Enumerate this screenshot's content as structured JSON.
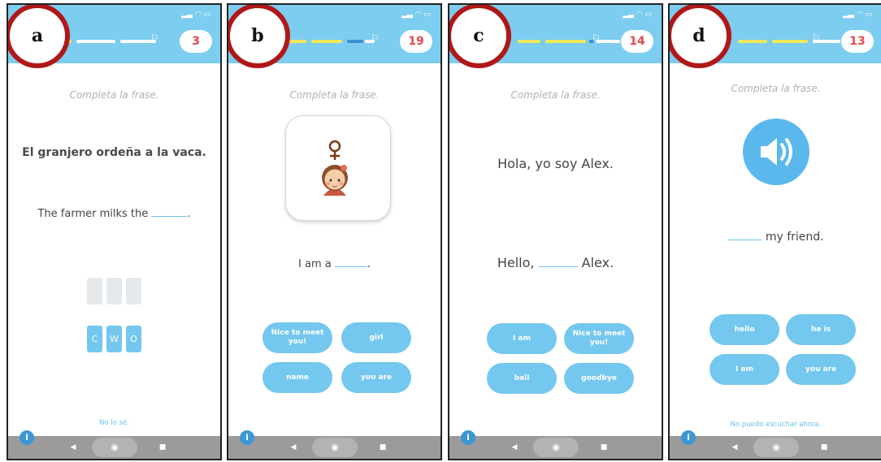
{
  "panels": [
    {
      "label": "a",
      "counter": "3",
      "instruction": "Completa la frase.",
      "prompt": "El granjero ordeña a la vaca.",
      "sentence_before": "The farmer milks the ",
      "sentence_after": ".",
      "letters": [
        "C",
        "W",
        "O"
      ],
      "footer": "No lo sé."
    },
    {
      "label": "b",
      "counter": "19",
      "instruction": "Completa la frase.",
      "picture_icon": "girl-avatar-icon",
      "sentence_before": "I am a ",
      "sentence_after": ".",
      "options": [
        "Nice to meet you!",
        "girl",
        "name",
        "you are"
      ]
    },
    {
      "label": "c",
      "counter": "14",
      "instruction": "Completa la frase.",
      "prompt": "Hola, yo soy Alex.",
      "sentence_before": "Hello, ",
      "sentence_after": " Alex.",
      "options": [
        "I am",
        "Nice to meet you!",
        "ball",
        "goodbye"
      ]
    },
    {
      "label": "d",
      "counter": "13",
      "instruction": "Completa la frase.",
      "audio_icon": "speaker-icon",
      "sentence_before": "",
      "sentence_after": " my friend.",
      "options": [
        "hello",
        "he is",
        "I am",
        "you are"
      ],
      "footer": "No puedo escuchar ahora."
    }
  ],
  "colors": {
    "header_blue": "#7ccdf0",
    "chip_blue": "#74c7ee",
    "progress_yellow": "#f2e85c",
    "badge_red": "#b01818",
    "counter_red": "#e5484d"
  }
}
